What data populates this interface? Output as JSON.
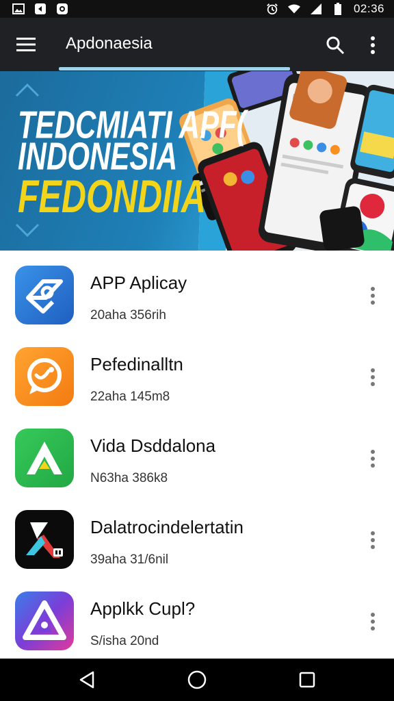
{
  "status_bar": {
    "time": "02:36",
    "left_icons": [
      "image-icon",
      "play-icon",
      "shield-icon"
    ],
    "right_icons": [
      "alarm-icon",
      "wifi-icon",
      "signal-icon",
      "battery-icon"
    ]
  },
  "app_bar": {
    "title": "Apdonaesia",
    "icons": [
      "menu-icon",
      "search-icon",
      "more-vert-icon"
    ]
  },
  "banner": {
    "line1": "TEDCMIATI APF(",
    "line2": "INDONESIA",
    "line3": "FEDONDIIA",
    "colors": {
      "text": "#ffffff",
      "highlight": "#f2d41b",
      "background": "#1e80b7"
    }
  },
  "apps": [
    {
      "name": "APP Aplicay",
      "meta": "20aha 356rih",
      "icon": "app-logo-icon",
      "icon_bg": "#2f7fd8"
    },
    {
      "name": "Pefedinalltn",
      "meta": "22aha 145m8",
      "icon": "chat-bubble-icon",
      "icon_bg": "#f7901e"
    },
    {
      "name": "Vida Dsddalona",
      "meta": "N63ha 386k8",
      "icon": "triangle-logo-icon",
      "icon_bg": "#2fbf4f"
    },
    {
      "name": "Dalatrocindelertatin",
      "meta": "39aha 31/6nil",
      "icon": "stylized-a-icon",
      "icon_bg": "#0b0b0b"
    },
    {
      "name": "Applkk Cupl?",
      "meta": "S/isha 20nd",
      "icon": "gradient-a-icon",
      "icon_bg": "#6a3bd1"
    }
  ],
  "nav_bar": {
    "icons": [
      "back-icon",
      "home-icon",
      "recents-icon"
    ]
  }
}
